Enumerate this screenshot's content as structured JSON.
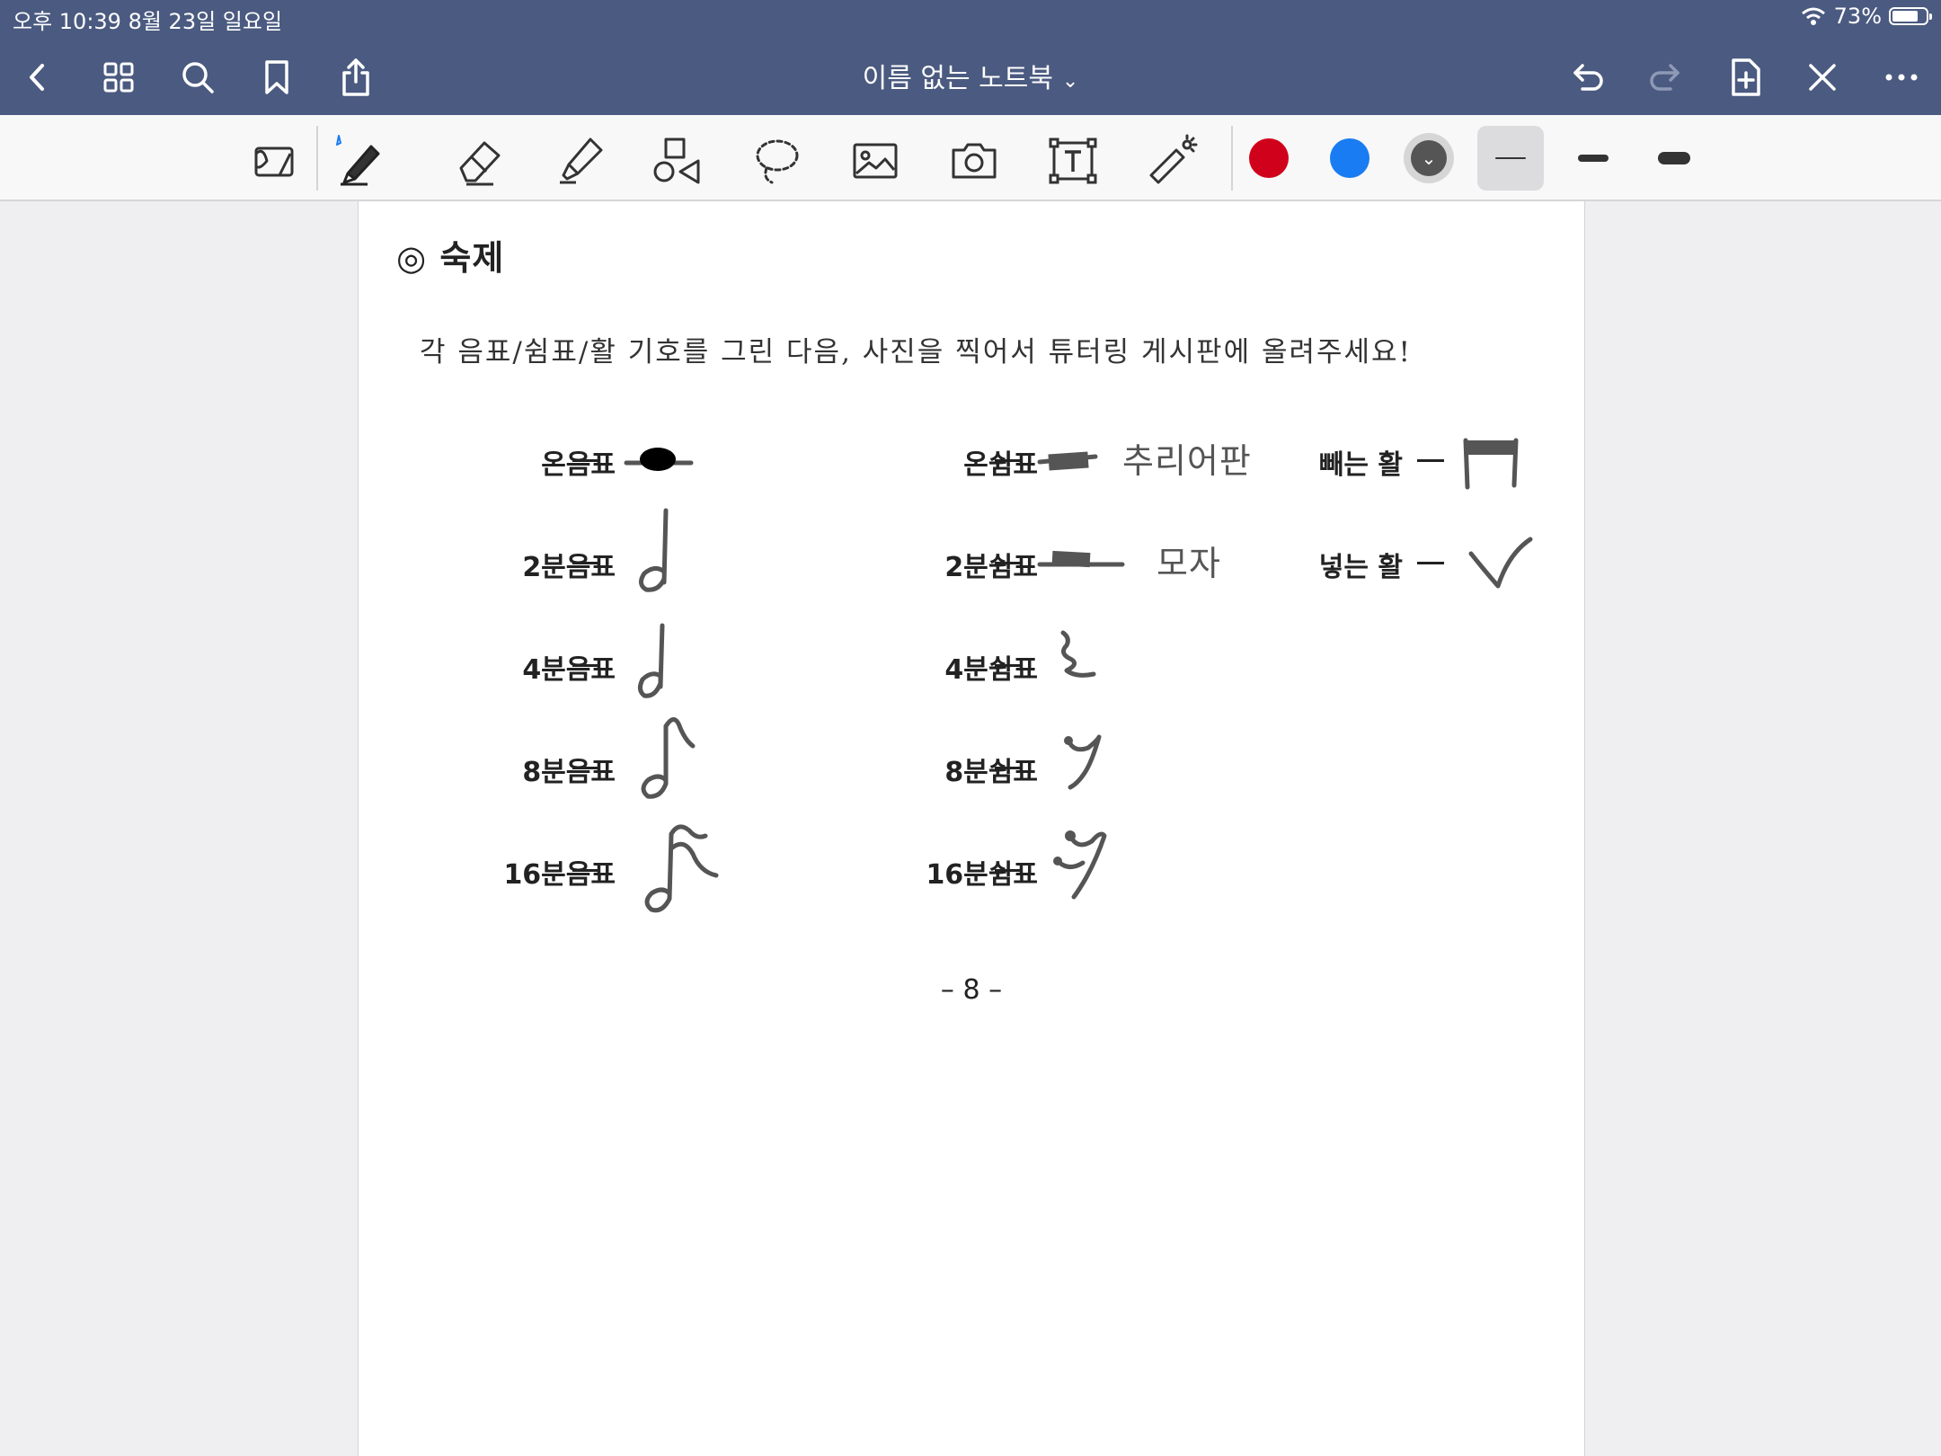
{
  "status": {
    "time": "오후 10:39   8월 23일 일요일",
    "battery": "73%",
    "battery_level": 0.73
  },
  "header": {
    "title": "이름 없는 노트북",
    "icons": [
      "chevron-left-icon",
      "grid-icon",
      "search-icon",
      "bookmark-icon",
      "share-icon",
      "undo-icon",
      "redo-icon",
      "add-page-icon",
      "close-pen-icon",
      "more-icon"
    ]
  },
  "toolbar": {
    "tools": [
      "shape-reader-icon",
      "pen-icon",
      "eraser-icon",
      "highlighter-icon",
      "shapes-icon",
      "lasso-icon",
      "image-icon",
      "camera-icon",
      "text-box-icon",
      "laser-pointer-icon"
    ],
    "colors": [
      "#d0021b",
      "#1a7cf2",
      "#555555"
    ],
    "sizes": [
      "thin",
      "medium",
      "thick"
    ]
  },
  "page": {
    "section_title": "◎ 숙제",
    "instruction": "각 음표/쉼표/활 기호를 그린 다음, 사진을 찍어서 튜터링 게시판에 올려주세요!",
    "notes": [
      "온음표",
      "2분음표",
      "4분음표",
      "8분음표",
      "16분음표"
    ],
    "rests": [
      "온쉼표",
      "2분쉼표",
      "4분쉼표",
      "8분쉼표",
      "16분쉼표"
    ],
    "bows": [
      "빼는 활",
      "넣는 활"
    ],
    "handwriting": {
      "whole_rest": "추리어판",
      "half_rest": "모자"
    },
    "page_number": "– 8 –"
  }
}
